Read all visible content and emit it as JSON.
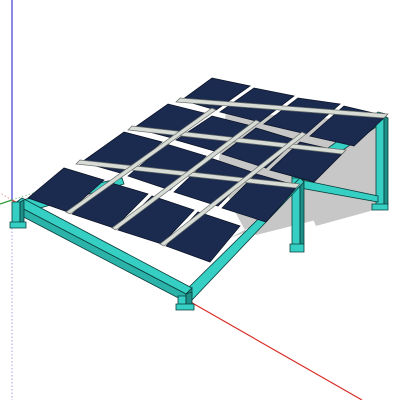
{
  "scene": {
    "model": "solar-panel-mounting-rack",
    "view": "perspective",
    "panel_grid": {
      "rows": 4,
      "columns": 4
    },
    "axes": {
      "red": "#d9302a",
      "green": "#2f9a3a",
      "blue": "#3b3bd6"
    },
    "colors": {
      "background": "#ffffff",
      "panel": "#1b2b4f",
      "panel_edge": "#0c1428",
      "rail": "#d8dcd6",
      "frame": "#35cfc4",
      "frame_dark": "#1c8f88",
      "frame_edge": "#0a3d3a",
      "shadow": "#c7c7c7"
    }
  }
}
